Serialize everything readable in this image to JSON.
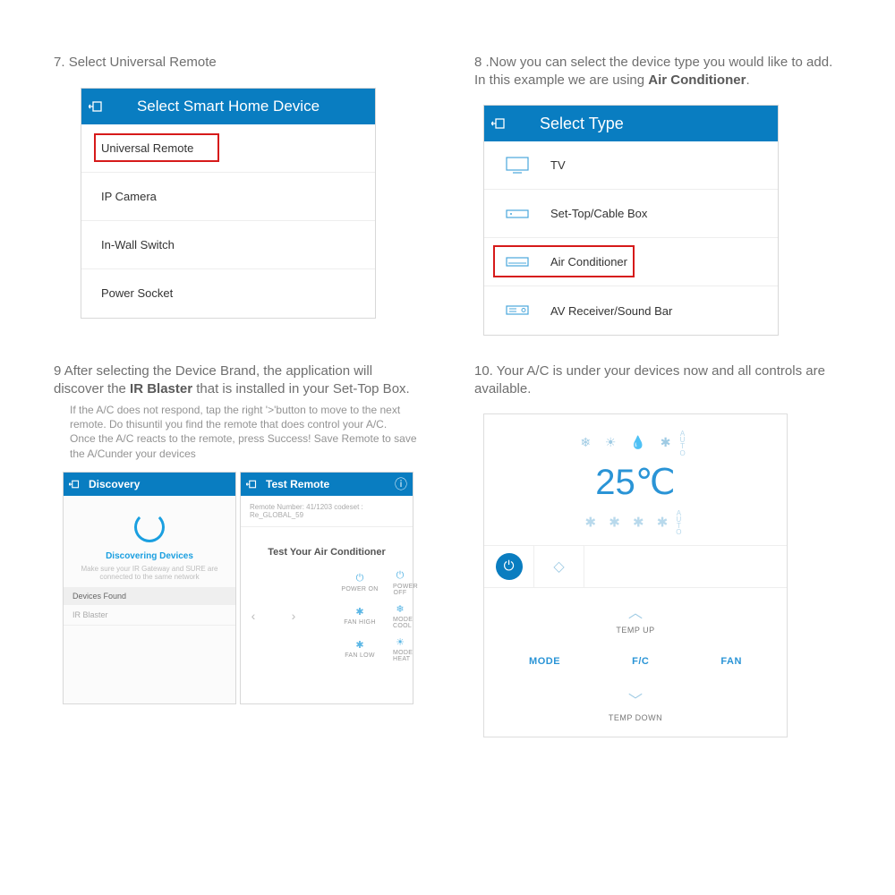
{
  "step7": {
    "num": "7.",
    "caption": "Select Universal Remote",
    "header": "Select Smart Home Device",
    "items": [
      "Universal Remote",
      "IP Camera",
      "In-Wall Switch",
      "Power Socket"
    ]
  },
  "step8": {
    "num": "8",
    "caption_a": ".Now you can select the device type you would like to add. In this example we are using ",
    "caption_b": "Air Conditioner",
    "caption_c": ".",
    "header": "Select Type",
    "items": [
      "TV",
      "Set-Top/Cable Box",
      "Air Conditioner",
      "AV Receiver/Sound Bar"
    ]
  },
  "step9": {
    "num": "9",
    "caption_a": "After selecting the Device Brand, the application will discover the ",
    "caption_b": "IR Blaster",
    "caption_c": " that is installed in your Set-Top Box.",
    "sub": "If the A/C does not respond, tap the right '>'button to move to the next remote. Do thisuntil you find the remote that does control your A/C.\nOnce the A/C reacts to the remote, press Success! Save Remote to save the A/Cunder your devices",
    "discovery": {
      "title": "Discovery",
      "status": "Discovering Devices",
      "hint": "Make sure your IR Gateway and SURE are connected to the same network",
      "found_header": "Devices Found",
      "found_item": "IR Blaster"
    },
    "test": {
      "title": "Test Remote",
      "meta": "Remote Number: 41/1203 codeset : Re_GLOBAL_59",
      "heading": "Test Your Air Conditioner",
      "buttons": [
        "POWER ON",
        "POWER OFF",
        "FAN HIGH",
        "MODE COOL",
        "FAN LOW",
        "MODE HEAT"
      ]
    }
  },
  "step10": {
    "num": "10.",
    "caption": "Your A/C is under your devices now and all controls are available.",
    "temp": "25℃",
    "temp_up": "TEMP UP",
    "temp_down": "TEMP DOWN",
    "mode": "MODE",
    "fc": "F/C",
    "fan": "FAN",
    "auto": "AUTO"
  }
}
